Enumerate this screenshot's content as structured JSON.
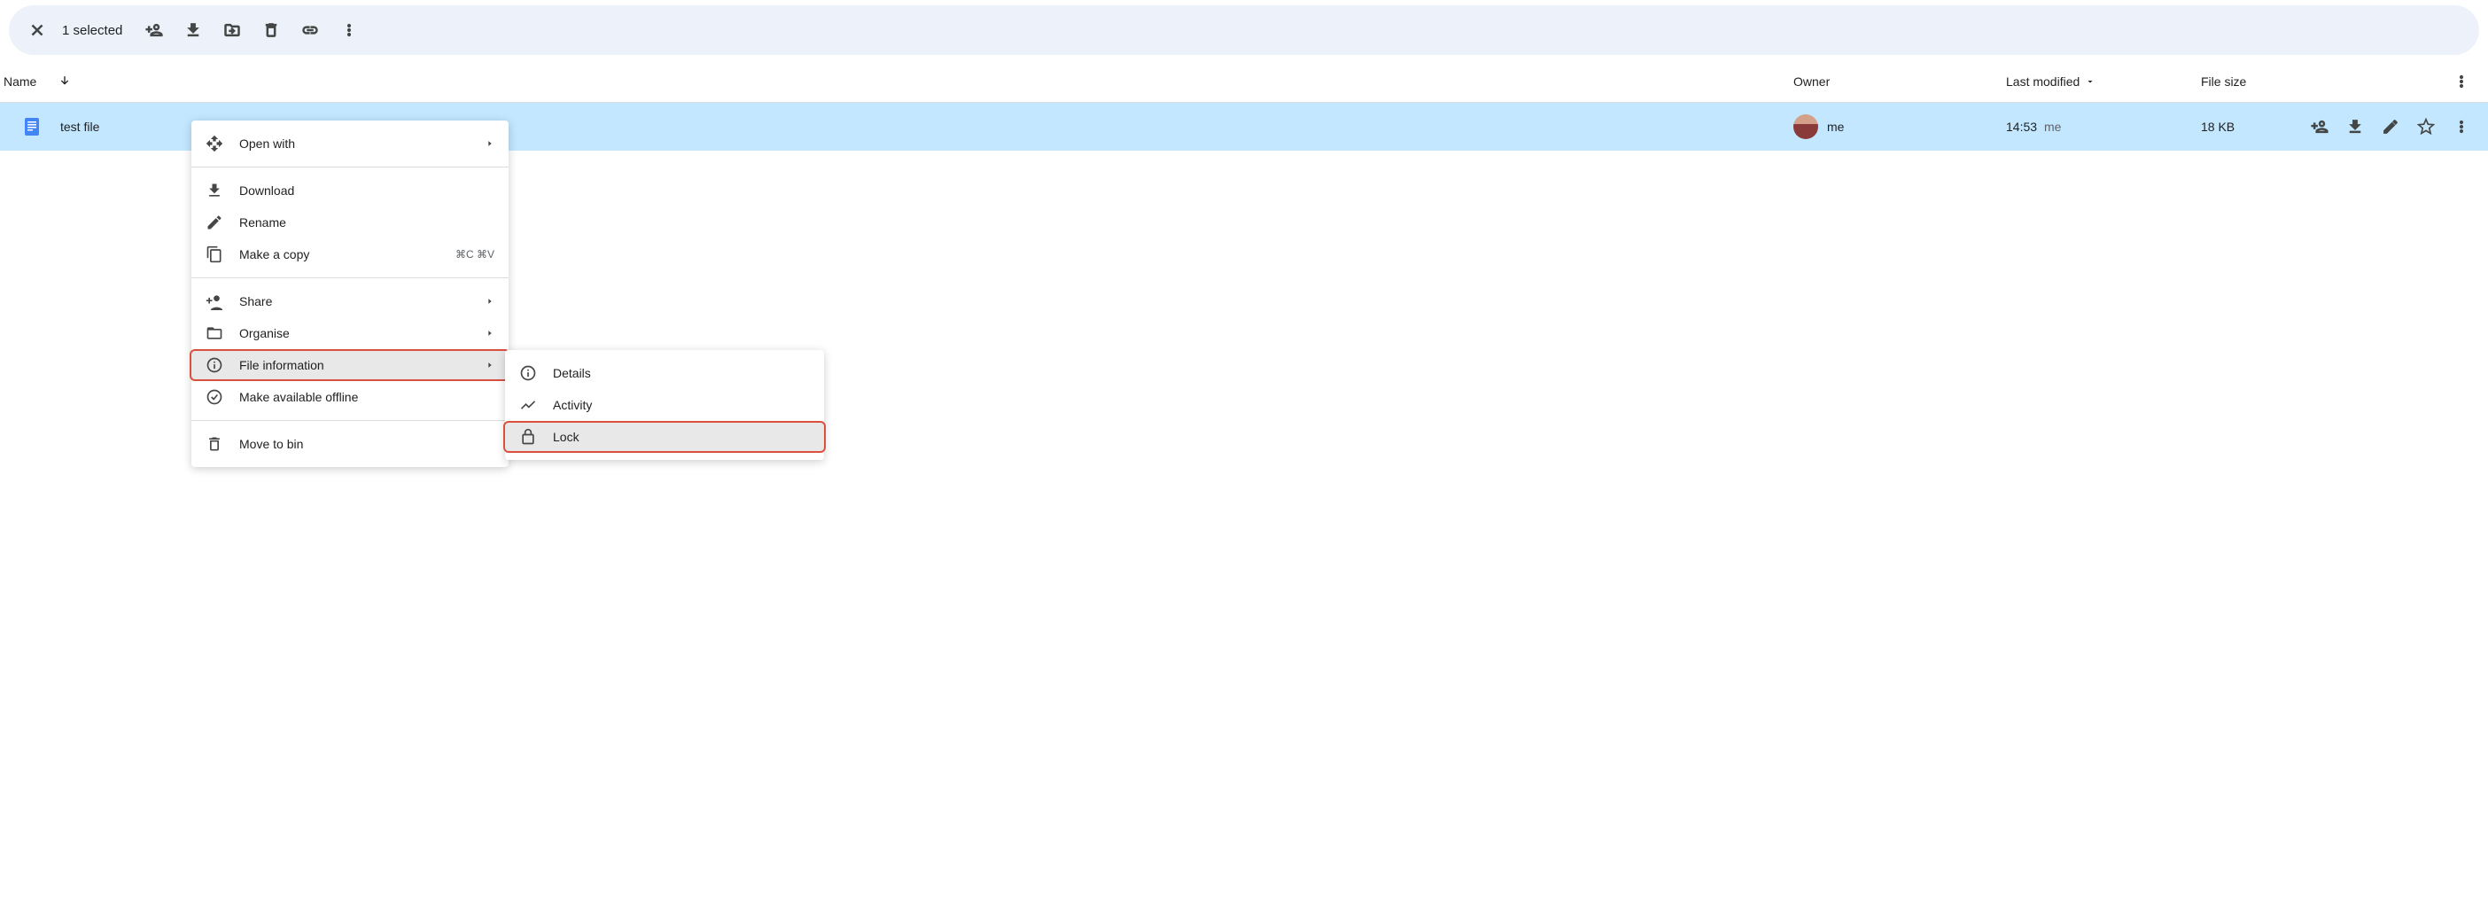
{
  "toolbar": {
    "selected_text": "1 selected"
  },
  "columns": {
    "name": "Name",
    "owner": "Owner",
    "modified": "Last modified",
    "size": "File size"
  },
  "file": {
    "name": "test file",
    "owner": "me",
    "modified_time": "14:53",
    "modified_by": "me",
    "size": "18 KB"
  },
  "context_menu": {
    "open_with": "Open with",
    "download": "Download",
    "rename": "Rename",
    "make_copy": "Make a copy",
    "make_copy_shortcut": "⌘C ⌘V",
    "share": "Share",
    "organise": "Organise",
    "file_information": "File information",
    "make_offline": "Make available offline",
    "move_to_bin": "Move to bin"
  },
  "submenu": {
    "details": "Details",
    "activity": "Activity",
    "lock": "Lock"
  }
}
